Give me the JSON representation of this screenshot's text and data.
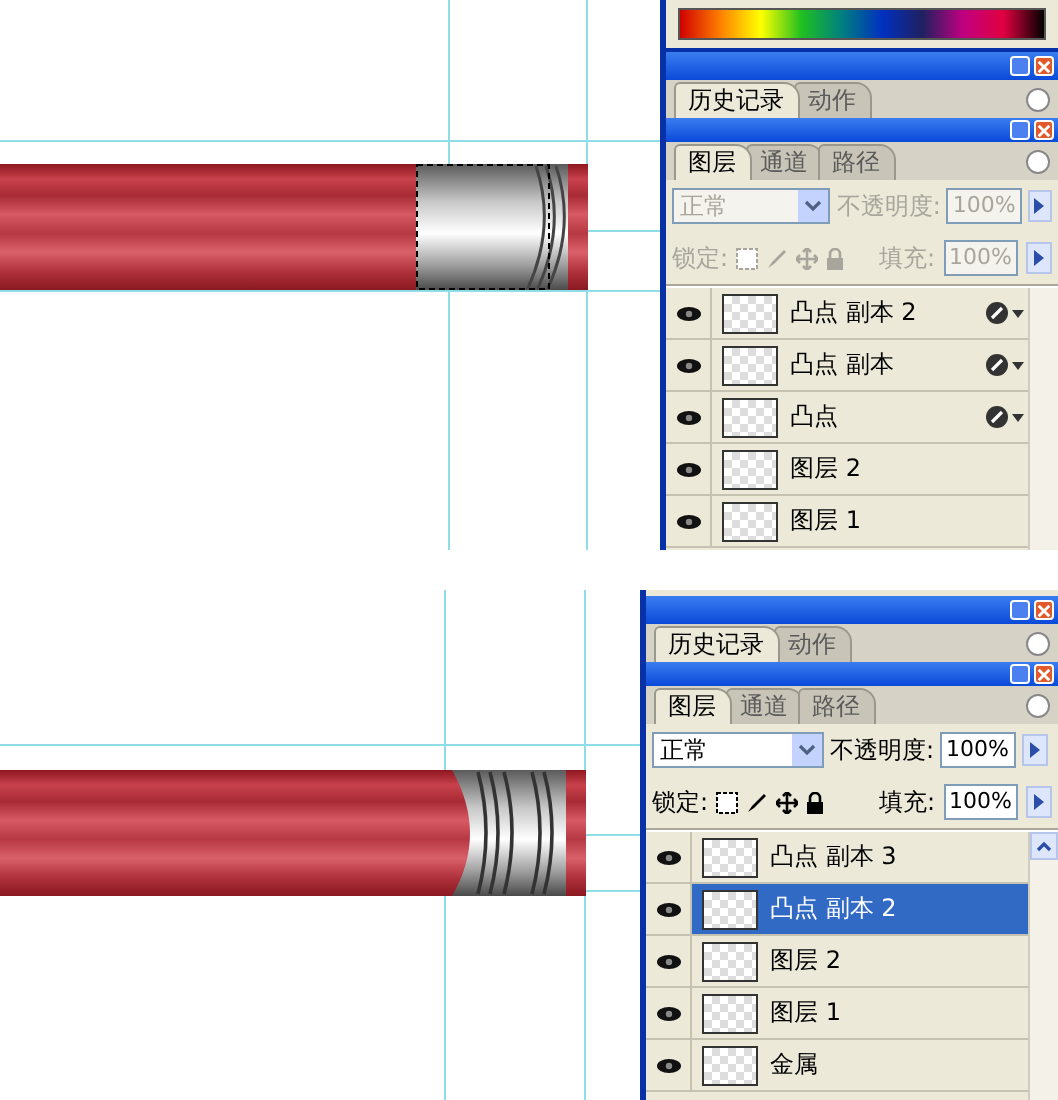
{
  "sections": [
    {
      "panel": {
        "color_picker": true,
        "disabled": true,
        "scroll_up_button": false,
        "history_tabs": [
          {
            "label": "历史记录",
            "selected": true
          },
          {
            "label": "动作",
            "selected": false
          }
        ],
        "layer_tabs": [
          {
            "label": "图层",
            "selected": true
          },
          {
            "label": "通道",
            "selected": false
          },
          {
            "label": "路径",
            "selected": false
          }
        ],
        "blend_mode": "正常",
        "opacity_label": "不透明度:",
        "opacity": "100%",
        "lock_label": "锁定:",
        "fill_label": "填充:",
        "fill": "100%",
        "layers": [
          {
            "name": "凸点 副本 2",
            "selected": false,
            "has_effects": true
          },
          {
            "name": "凸点 副本",
            "selected": false,
            "has_effects": true
          },
          {
            "name": "凸点",
            "selected": false,
            "has_effects": true
          },
          {
            "name": "图层 2",
            "selected": false,
            "has_effects": false
          },
          {
            "name": "图层 1",
            "selected": false,
            "has_effects": false
          }
        ]
      }
    },
    {
      "panel": {
        "color_picker": false,
        "disabled": false,
        "scroll_up_button": true,
        "history_tabs": [
          {
            "label": "历史记录",
            "selected": true
          },
          {
            "label": "动作",
            "selected": false
          }
        ],
        "layer_tabs": [
          {
            "label": "图层",
            "selected": true
          },
          {
            "label": "通道",
            "selected": false
          },
          {
            "label": "路径",
            "selected": false
          }
        ],
        "blend_mode": "正常",
        "opacity_label": "不透明度:",
        "opacity": "100%",
        "lock_label": "锁定:",
        "fill_label": "填充:",
        "fill": "100%",
        "layers": [
          {
            "name": "凸点 副本 3",
            "selected": false,
            "has_effects": false
          },
          {
            "name": "凸点 副本 2",
            "selected": true,
            "has_effects": false
          },
          {
            "name": "图层 2",
            "selected": false,
            "has_effects": false
          },
          {
            "name": "图层 1",
            "selected": false,
            "has_effects": false
          },
          {
            "name": "金属",
            "selected": false,
            "has_effects": false
          }
        ]
      }
    }
  ]
}
